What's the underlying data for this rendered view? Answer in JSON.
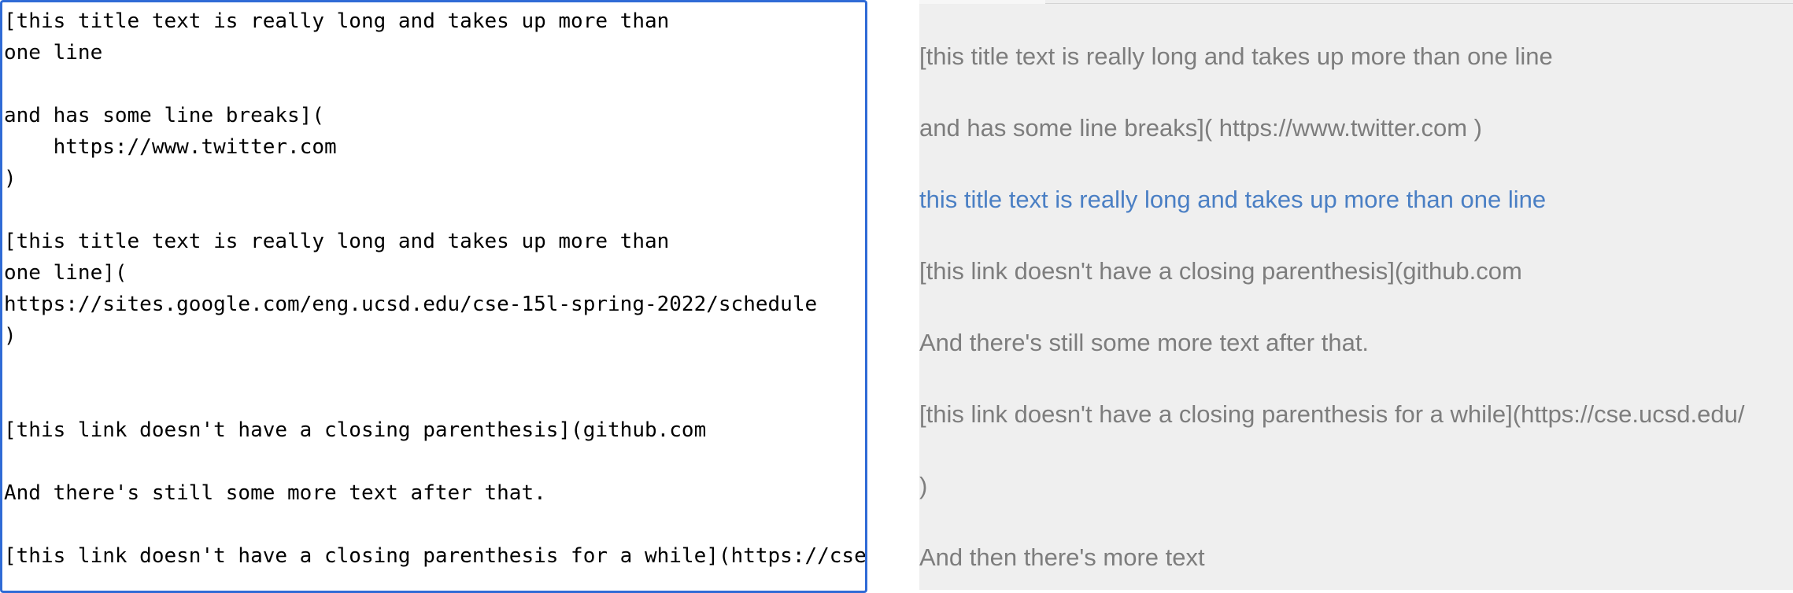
{
  "editor": {
    "text": "[this title text is really long and takes up more than\none line\n\nand has some line breaks](\n    https://www.twitter.com\n)\n\n[this title text is really long and takes up more than\none line](\nhttps://sites.google.com/eng.ucsd.edu/cse-15l-spring-2022/schedule\n)\n\n\n[this link doesn't have a closing parenthesis](github.com\n\nAnd there's still some more text after that.\n\n[this link doesn't have a closing parenthesis for a while](https://cse.ucsd.edu/"
  },
  "preview": {
    "line1": "[this title text is really long and takes up more than one line",
    "line2": "and has some line breaks]( https://www.twitter.com )",
    "link": "this title text is really long and takes up more than one line",
    "line4": "[this link doesn't have a closing parenthesis](github.com",
    "line5": "And there's still some more text after that.",
    "line6": "[this link doesn't have a closing parenthesis for a while](https://cse.ucsd.edu/",
    "line7": ")",
    "line8": "And then there's more text"
  },
  "colors": {
    "editor_border": "#2f6bd6",
    "preview_background": "#efefef",
    "preview_text": "#7d7d7d",
    "link": "#4a7fc4"
  }
}
